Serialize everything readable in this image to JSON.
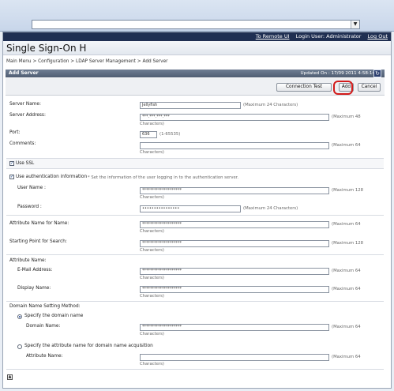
{
  "topbar": {
    "to_remote_ui": "To Remote UI",
    "login_user": "Login User: Administrator",
    "log_out": "Log Out"
  },
  "brand": {
    "title": "Single Sign-On H"
  },
  "breadcrumb": "Main Menu > Configuration > LDAP Server Management > Add Server",
  "panel": {
    "title": "Add Server",
    "updated": "Updated On : 17/09 2011 4:58:14"
  },
  "buttons": {
    "connection_test": "Connection Test",
    "add": "Add",
    "cancel": "Cancel"
  },
  "fields": {
    "server_name": {
      "label": "Server Name:",
      "value": "Jellyfish",
      "hint": "(Maximum 24 Characters)"
    },
    "server_address": {
      "label": "Server Address:",
      "value": "***.***.***.***",
      "hint": "(Maximum 48",
      "hint2": "Characters)"
    },
    "port": {
      "label": "Port:",
      "value": "636",
      "hint": "(1-65535)"
    },
    "comments": {
      "label": "Comments:",
      "value": "",
      "hint": "(Maximum 64",
      "hint2": "Characters)"
    },
    "use_ssl": {
      "label": "Use SSL"
    },
    "use_auth": {
      "label": "Use authentication information",
      "note": "* Set the information of the user logging in to the authentication server."
    },
    "user_name": {
      "label": "User Name :",
      "value": "********************",
      "hint": "(Maximum 128",
      "hint2": "Characters)"
    },
    "password": {
      "label": "Password :",
      "value": "••••••••••••••••",
      "hint": "(Maximum 24 Characters)"
    },
    "attr_name_for_name": {
      "label": "Attribute Name for Name:",
      "value": "********************",
      "hint": "(Maximum 64",
      "hint2": "Characters)"
    },
    "starting_point": {
      "label": "Starting Point for Search:",
      "value": "********************",
      "hint": "(Maximum 128",
      "hint2": "Characters)"
    },
    "attribute_name": {
      "label": "Attribute Name:"
    },
    "email_address": {
      "label": "E-Mail Address:",
      "value": "********************",
      "hint": "(Maximum 64",
      "hint2": "Characters)"
    },
    "display_name": {
      "label": "Display Name:",
      "value": "********************",
      "hint": "(Maximum 64",
      "hint2": "Characters)"
    },
    "domain_method": {
      "label": "Domain Name Setting Method:"
    },
    "specify_domain": {
      "label": "Specify the domain name"
    },
    "domain_name": {
      "label": "Domain Name:",
      "value": "********************",
      "hint": "(Maximum 64",
      "hint2": "Characters)"
    },
    "specify_attr_domain": {
      "label": "Specify the attribute name for domain name acquisition"
    },
    "attr_name_domain": {
      "label": "Attribute Name:",
      "value": "",
      "hint": "(Maximum 64",
      "hint2": "Characters)"
    }
  }
}
